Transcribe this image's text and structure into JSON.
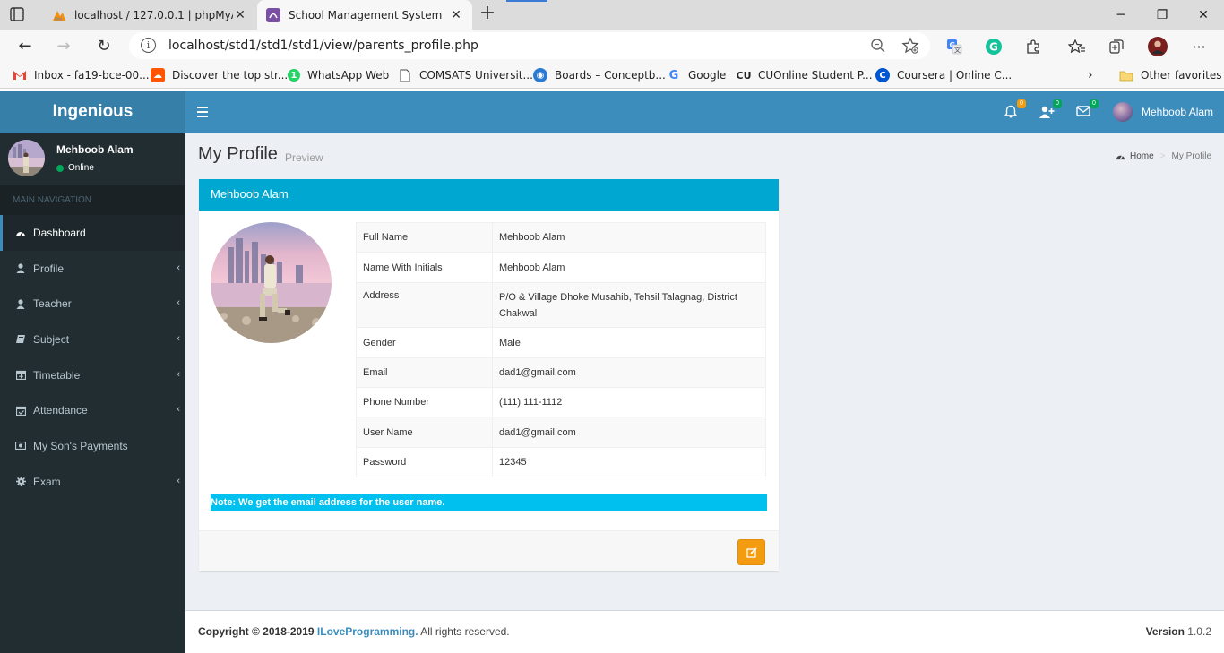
{
  "browser": {
    "tabs": [
      {
        "title": "localhost / 127.0.0.1 | phpMyAdm",
        "favicon": "phpmyadmin-icon"
      },
      {
        "title": "School Management System",
        "favicon": "app-icon"
      }
    ],
    "address": "localhost/std1/std1/std1/view/parents_profile.php",
    "bookmarks": [
      {
        "label": "Inbox - fa19-bce-00...",
        "icon": "gmail-icon"
      },
      {
        "label": "Discover the top str...",
        "icon": "soundcloud-icon"
      },
      {
        "label": "WhatsApp Web",
        "icon": "whatsapp-icon"
      },
      {
        "label": "COMSATS Universit...",
        "icon": "page-icon"
      },
      {
        "label": "Boards – Conceptb...",
        "icon": "conceptboard-icon"
      },
      {
        "label": "Google",
        "icon": "google-icon"
      },
      {
        "label": "CUOnline Student P...",
        "icon": "cu-icon"
      },
      {
        "label": "Coursera | Online C...",
        "icon": "coursera-icon"
      },
      {
        "label": "Other favorites",
        "icon": "folder-icon"
      }
    ]
  },
  "app": {
    "logo": "Ingenious",
    "header_user": "Mehboob Alam",
    "badges": {
      "notifications": "0",
      "requests": "0",
      "messages": "0"
    }
  },
  "sidebar": {
    "user_name": "Mehboob Alam",
    "status": "Online",
    "nav_header": "MAIN NAVIGATION",
    "items": [
      {
        "label": "Dashboard",
        "icon": "dashboard-icon",
        "active": true,
        "has_submenu": false
      },
      {
        "label": "Profile",
        "icon": "user-icon",
        "has_submenu": true
      },
      {
        "label": "Teacher",
        "icon": "user-icon",
        "has_submenu": true
      },
      {
        "label": "Subject",
        "icon": "book-icon",
        "has_submenu": true
      },
      {
        "label": "Timetable",
        "icon": "calendar-plus-icon",
        "has_submenu": true
      },
      {
        "label": "Attendance",
        "icon": "calendar-check-icon",
        "has_submenu": true
      },
      {
        "label": "My Son's Payments",
        "icon": "money-icon",
        "has_submenu": false
      },
      {
        "label": "Exam",
        "icon": "gear-icon",
        "has_submenu": true
      }
    ]
  },
  "page": {
    "title": "My Profile",
    "subtitle": "Preview",
    "breadcrumb": {
      "home": "Home",
      "current": "My Profile"
    }
  },
  "profile": {
    "box_title": "Mehboob Alam",
    "rows": [
      {
        "label": "Full Name",
        "value": "Mehboob Alam"
      },
      {
        "label": "Name With Initials",
        "value": "Mehboob Alam"
      },
      {
        "label": "Address",
        "value": "P/O & Village Dhoke Musahib, Tehsil Talagnag, District Chakwal"
      },
      {
        "label": "Gender",
        "value": "Male"
      },
      {
        "label": "Email",
        "value": "dad1@gmail.com"
      },
      {
        "label": "Phone Number",
        "value": "(111) 111-1112"
      },
      {
        "label": "User Name",
        "value": "dad1@gmail.com"
      },
      {
        "label": "Password",
        "value": "12345"
      }
    ],
    "note": "Note: We get the email address for the user name."
  },
  "footer": {
    "copyright_prefix": "Copyright © 2018-2019",
    "brand": "ILoveProgramming.",
    "suffix": "All rights reserved.",
    "version_label": "Version",
    "version": "1.0.2"
  },
  "colors": {
    "header": "#3c8dbc",
    "sidebar": "#222d32",
    "box_header": "#00a7d0",
    "note": "#00c0ef",
    "edit_button": "#f39c12"
  }
}
